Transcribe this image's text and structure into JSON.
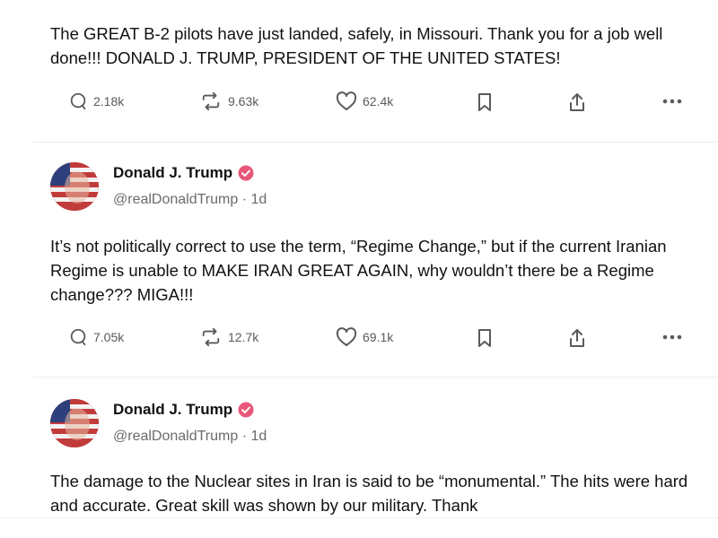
{
  "posts": [
    {
      "text": "The GREAT B-2 pilots have just landed, safely, in Missouri. Thank you for a job well done!!! DONALD J. TRUMP, PRESIDENT OF THE UNITED STATES!",
      "actions": {
        "replies": "2.18k",
        "reposts": "9.63k",
        "likes": "62.4k"
      }
    },
    {
      "author": {
        "name": "Donald J. Trump",
        "handle": "@realDonaldTrump · 1d",
        "verified": true
      },
      "text": "It’s not politically correct to use the term, “Regime Change,” but if the current Iranian Regime is unable to MAKE IRAN GREAT AGAIN, why wouldn’t there be a Regime change??? MIGA!!!",
      "actions": {
        "replies": "7.05k",
        "reposts": "12.7k",
        "likes": "69.1k"
      }
    },
    {
      "author": {
        "name": "Donald J. Trump",
        "handle": "@realDonaldTrump · 1d",
        "verified": true
      },
      "text": "The damage to the Nuclear sites in Iran is said to be “monumental.” The hits were hard and accurate. Great skill was shown by our military. Thank"
    }
  ],
  "icons": {
    "reply": "speech-bubble-icon",
    "repost": "repost-arrows-icon",
    "like": "heart-icon",
    "bookmark": "bookmark-icon",
    "share": "share-upload-icon",
    "more": "more-dots-icon",
    "verified": "verified-badge-icon"
  },
  "colors": {
    "verified": "#e8577a",
    "text": "#111111",
    "muted": "#6b6b6b",
    "icon": "#5a5a5a"
  }
}
